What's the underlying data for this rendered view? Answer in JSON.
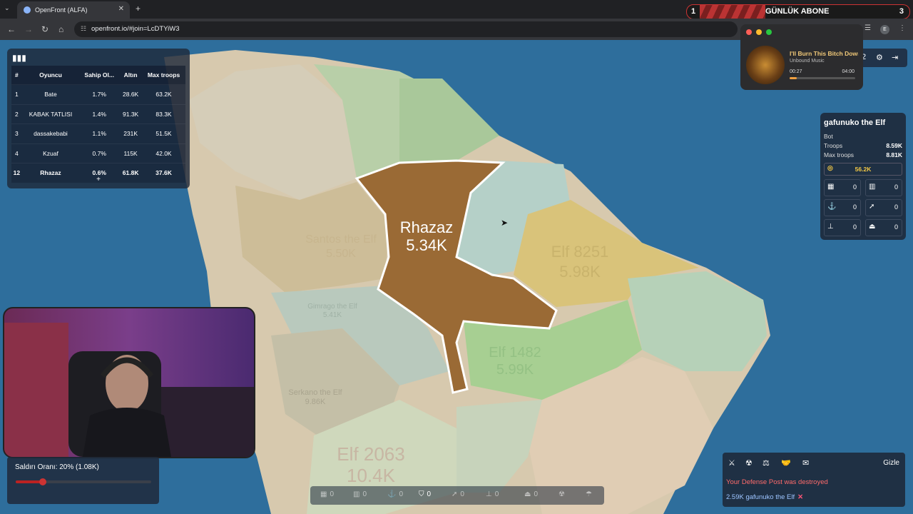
{
  "browser": {
    "tab_title": "OpenFront (ALFA)",
    "url": "openfront.io/#join=LcDTYiW3",
    "profile_initial": "E"
  },
  "banner": {
    "left_count": "1",
    "label": "GÜNLÜK ABONE",
    "right_count": "3"
  },
  "music": {
    "title": "I'll Burn This Bitch Down",
    "artist": "Unbound Music",
    "elapsed": "00:27",
    "duration": "04:00",
    "progress": 0.11
  },
  "leaderboard": {
    "headers": [
      "#",
      "Oyuncu",
      "Sahip Ol...",
      "Altın",
      "Max troops"
    ],
    "rows": [
      {
        "rank": "1",
        "player": "Bate",
        "owned": "1.7%",
        "gold": "28.6K",
        "troops": "63.2K"
      },
      {
        "rank": "2",
        "player": "KABAK TATLISI",
        "owned": "1.4%",
        "gold": "91.3K",
        "troops": "83.3K"
      },
      {
        "rank": "3",
        "player": "dassakebabi",
        "owned": "1.1%",
        "gold": "231K",
        "troops": "51.5K"
      },
      {
        "rank": "4",
        "player": "Kzuaf",
        "owned": "0.7%",
        "gold": "115K",
        "troops": "42.0K"
      },
      {
        "rank": "12",
        "player": "Rhazaz",
        "owned": "0.6%",
        "gold": "61.8K",
        "troops": "37.6K"
      }
    ],
    "more": "+"
  },
  "map_labels": {
    "player_name": "Rhazaz",
    "player_troops": "5.34K",
    "terr1_name": "Santos the Elf",
    "terr1_val": "5.50K",
    "terr2_name": "Elf 8251",
    "terr2_val": "5.98K",
    "terr3_name": "Elf 1482",
    "terr3_val": "5.99K",
    "terr4_name": "Serkano the Elf",
    "terr4_val": "9.86K",
    "terr5_name": "Elf 2063",
    "terr5_val": "10.4K",
    "terr6_name": "Gimrago the Elf",
    "terr6_val": "5.41K"
  },
  "controls": {
    "count": "2"
  },
  "player_info": {
    "name": "gafunuko the Elf",
    "type": "Bot",
    "troops_label": "Troops",
    "troops": "8.59K",
    "max_troops_label": "Max troops",
    "max_troops": "8.81K",
    "gold": "56.2K",
    "buildings": [
      "0",
      "0",
      "0",
      "0",
      "0",
      "0"
    ]
  },
  "attack": {
    "label": "Saldırı Oranı: 20% (1.08K)",
    "ratio": 0.2
  },
  "build_bar": {
    "counts": [
      "0",
      "0",
      "0",
      "0",
      "0",
      "0",
      "0"
    ]
  },
  "events": {
    "hide_label": "Gizle",
    "message1": "Your Defense Post was destroyed",
    "message2": "2.59K gafunuko the Elf"
  },
  "colors": {
    "ocean": "#2b6a97",
    "player_territory": "#9a6a35",
    "panel_bg": "#1e293b",
    "gold": "#f2c744",
    "alert": "#ff6b6b"
  }
}
